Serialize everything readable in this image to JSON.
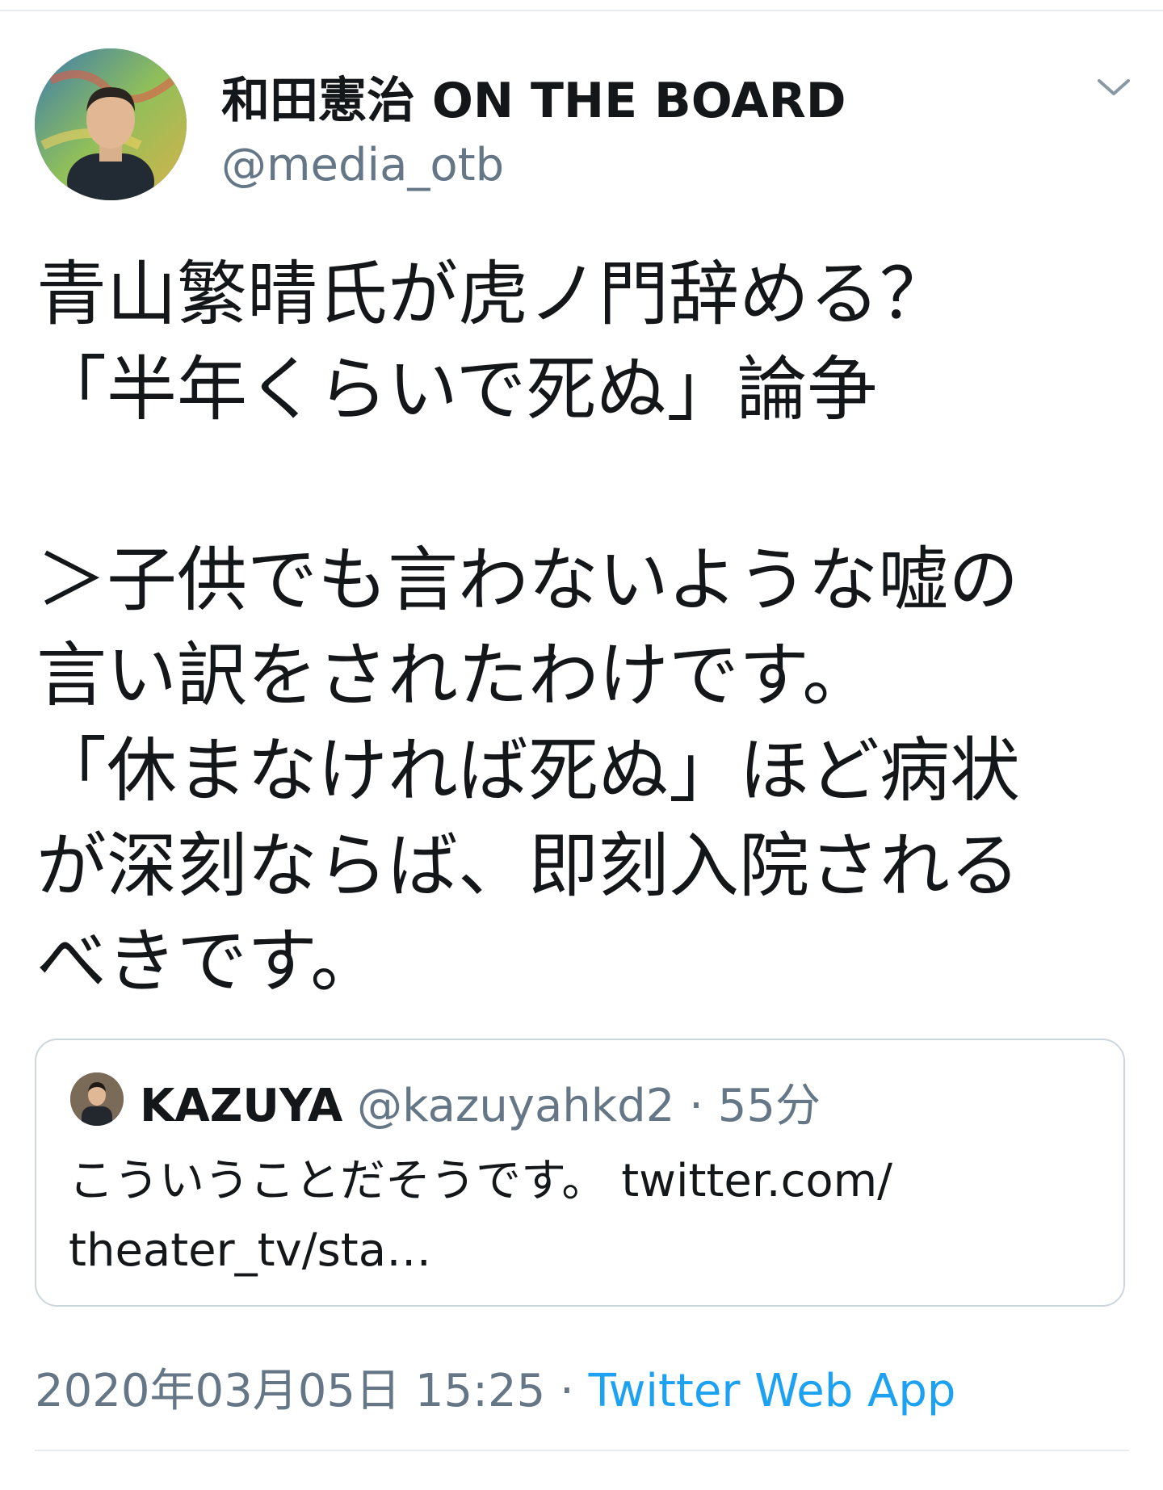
{
  "author": {
    "display_name": "和田憲治 ON THE BOARD",
    "handle": "@media_otb",
    "avatar_icon": "person-photo-avatar"
  },
  "menu_icon": "chevron-down-icon",
  "tweet": {
    "lines": [
      "青山繁晴氏が虎ノ門辞める？",
      "「半年くらいで死ぬ」論争",
      "",
      "＞子供でも言わないような嘘の",
      "言い訳をされたわけです。",
      "「休まなければ死ぬ」ほど病状",
      "が深刻ならば、即刻入院される",
      "べきです。"
    ]
  },
  "quoted_tweet": {
    "name": "KAZUYA",
    "handle": "@kazuyahkd2",
    "separator": "·",
    "time": "55分",
    "text_lines": [
      "こういうことだそうです。 twitter.com/",
      "theater_tv/sta…"
    ]
  },
  "meta": {
    "timestamp": "2020年03月05日 15:25",
    "separator": "·",
    "source": "Twitter Web App"
  },
  "colors": {
    "text": "#14171a",
    "secondary": "#657786",
    "link": "#1da1f2",
    "border": "#ccd6dd"
  }
}
